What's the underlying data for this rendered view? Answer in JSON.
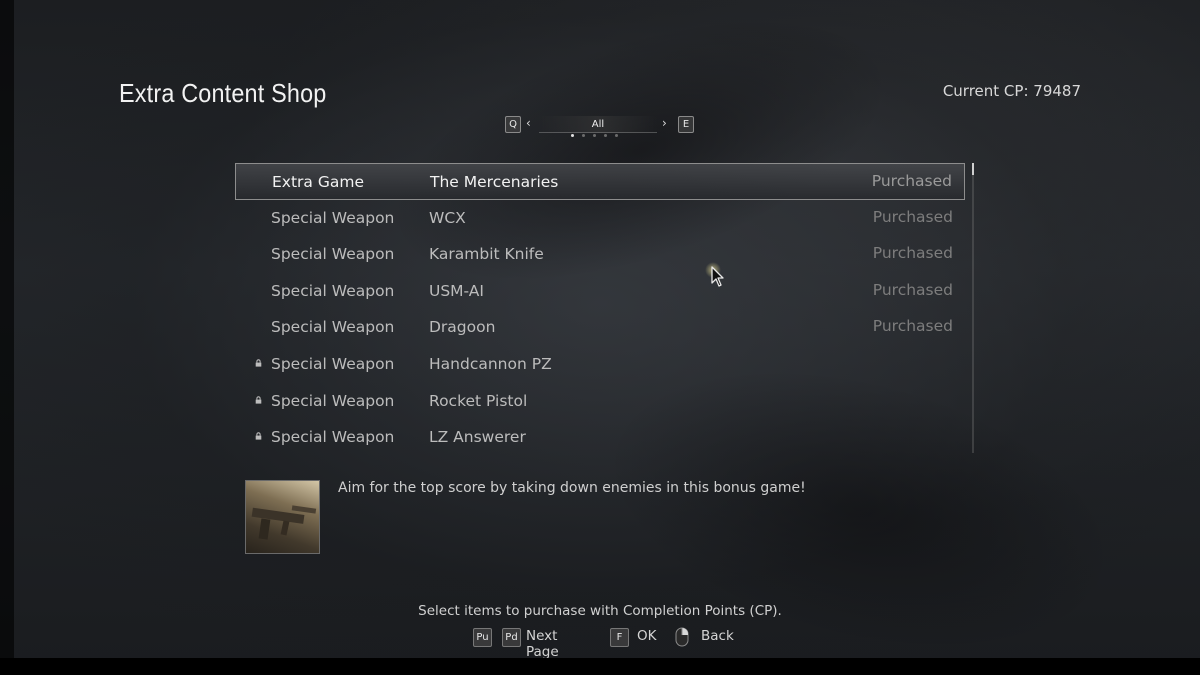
{
  "header": {
    "title": "Extra Content Shop",
    "cp_label": "Current CP: 79487"
  },
  "category_selector": {
    "prev_key": "Q",
    "next_key": "E",
    "current": "All",
    "page_count": 5,
    "active_page": 1
  },
  "items": [
    {
      "category": "Extra Game",
      "name": "The Mercenaries",
      "status": "Purchased",
      "locked": false,
      "selected": true
    },
    {
      "category": "Special Weapon",
      "name": "WCX",
      "status": "Purchased",
      "locked": false,
      "selected": false
    },
    {
      "category": "Special Weapon",
      "name": "Karambit Knife",
      "status": "Purchased",
      "locked": false,
      "selected": false
    },
    {
      "category": "Special Weapon",
      "name": "USM-AI",
      "status": "Purchased",
      "locked": false,
      "selected": false
    },
    {
      "category": "Special Weapon",
      "name": "Dragoon",
      "status": "Purchased",
      "locked": false,
      "selected": false
    },
    {
      "category": "Special Weapon",
      "name": "Handcannon PZ",
      "status": "",
      "locked": true,
      "selected": false
    },
    {
      "category": "Special Weapon",
      "name": "Rocket Pistol",
      "status": "",
      "locked": true,
      "selected": false
    },
    {
      "category": "Special Weapon",
      "name": "LZ Answerer",
      "status": "",
      "locked": true,
      "selected": false
    }
  ],
  "detail": {
    "thumbnail": "mercenaries-thumbnail",
    "description": "Aim for the top score by taking down enemies in this bonus game!"
  },
  "footer": {
    "hint": "Select items to purchase with Completion Points (CP).",
    "controls": {
      "pageup_key": "Pu",
      "pagedown_key": "Pd",
      "next_page_label": "Next Page",
      "ok_key": "F",
      "ok_label": "OK",
      "back_icon": "mouse-icon",
      "back_label": "Back"
    }
  },
  "colors": {
    "selected_row_border": "#8d8d8d",
    "status_text": "#7d7d7d",
    "primary_text": "#f2f2f2"
  }
}
